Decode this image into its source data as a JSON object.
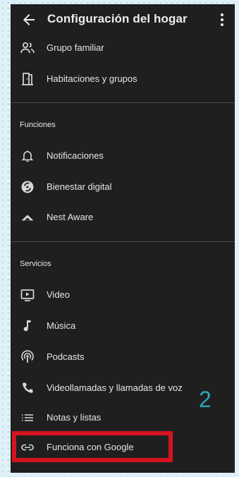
{
  "appbar": {
    "title": "Configuración del hogar",
    "back_icon": "arrow-back-icon",
    "more_icon": "more-vert-icon"
  },
  "items_top": [
    {
      "label": "Grupo familiar",
      "icon": "family-group-icon"
    },
    {
      "label": "Habitaciones y grupos",
      "icon": "door-icon"
    }
  ],
  "section_funciones": "Funciones",
  "items_funciones": [
    {
      "label": "Notificaciones",
      "icon": "bell-icon"
    },
    {
      "label": "Bienestar digital",
      "icon": "digital-wellbeing-icon"
    },
    {
      "label": "Nest Aware",
      "icon": "nest-aware-icon"
    }
  ],
  "section_servicios": "Servicios",
  "items_servicios": [
    {
      "label": "Video",
      "icon": "video-icon"
    },
    {
      "label": "Música",
      "icon": "music-note-icon"
    },
    {
      "label": "Podcasts",
      "icon": "podcast-icon"
    },
    {
      "label": "Videollamadas y llamadas de voz",
      "icon": "phone-icon"
    },
    {
      "label": "Notas y listas",
      "icon": "list-icon"
    },
    {
      "label": "Funciona con Google",
      "icon": "link-icon"
    }
  ],
  "annotation": {
    "step_number": "2",
    "highlight_color": "#d4141e",
    "number_color": "#2aa6b8"
  },
  "colors": {
    "background": "#1f1f1f",
    "text": "#e6e6e6",
    "divider": "#4a4a4a"
  }
}
